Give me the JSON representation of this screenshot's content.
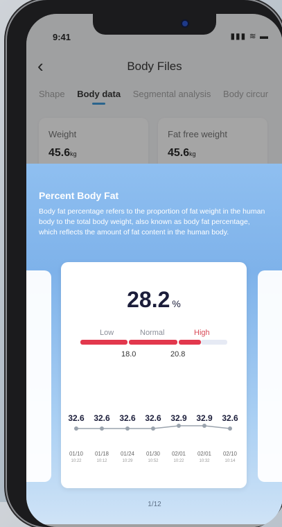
{
  "status": {
    "time": "9:41",
    "icons": "..ıl ≋ ▬"
  },
  "header": {
    "title": "Body Files",
    "back_icon": "chevron-left-icon"
  },
  "tabs": [
    "Shape",
    "Body data",
    "Segmental analysis",
    "Body circur"
  ],
  "active_tab": 1,
  "metrics": [
    {
      "label": "Weight",
      "value": "45.6",
      "unit": "kg"
    },
    {
      "label": "Fat free weight",
      "value": "45.6",
      "unit": "kg"
    }
  ],
  "sheet": {
    "title": "Percent Body Fat",
    "description": "Body fat percentage refers to the proportion of fat weight in the human body to the total body weight, also known as body fat percentage, which reflects the amount of fat content in the human body."
  },
  "card": {
    "value": "28.2",
    "unit": "%",
    "ranges": [
      "Low",
      "Normal",
      "High"
    ],
    "thresholds": [
      "18.0",
      "20.8"
    ],
    "fill_fraction": 0.76
  },
  "trend": {
    "values": [
      "32.6",
      "32.6",
      "32.6",
      "32.6",
      "32.9",
      "32.9",
      "32.6"
    ],
    "dates": [
      "01/10",
      "01/18",
      "01/24",
      "01/30",
      "02/01",
      "02/01",
      "02/10"
    ],
    "times": [
      "10:22",
      "10:12",
      "10:29",
      "10:52",
      "10:22",
      "10:32",
      "10:14"
    ]
  },
  "pager": "1/12",
  "colors": {
    "accent": "#2b8fd6",
    "high": "#e2384d",
    "sheet": "#8fbff0"
  }
}
